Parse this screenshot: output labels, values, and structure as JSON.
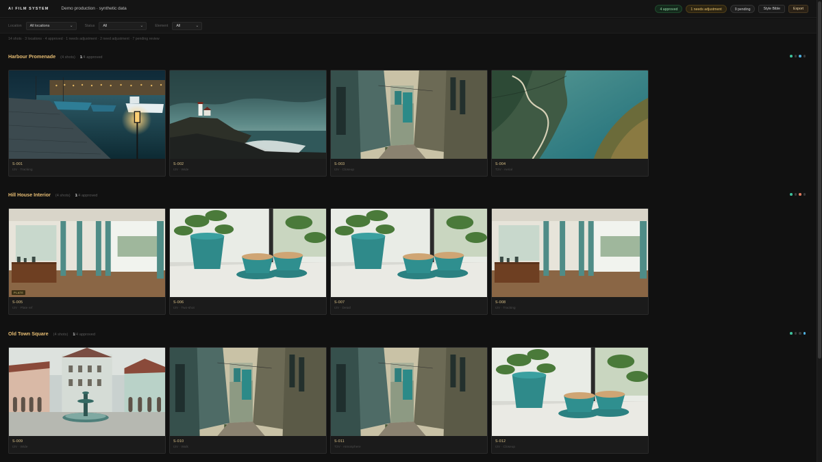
{
  "header": {
    "brand": "AI FILM SYSTEM",
    "project": "Demo production · synthetic data",
    "badges": {
      "approved": "4 approved",
      "adjust": "1 needs adjustment",
      "pending": "9 pending"
    },
    "style_bible": "Style Bible",
    "export": "Export"
  },
  "filters": {
    "location_label": "Location",
    "location_value": "All locations",
    "status_label": "Status",
    "status_value": "All",
    "element_label": "Element",
    "element_value": "All"
  },
  "summary": "14 shots · 3 locations · 4 approved · 1 needs adjustment · 2 need adjustment · 7 pending review",
  "sections": [
    {
      "title": "Harbour Promenade",
      "count": "(4 shots)",
      "approved_num": "1",
      "approved_rest": "/4 approved",
      "dot_colors": [
        "#3fbf9a",
        "#3a3a3a",
        "#4fb0e0",
        "#3a3a3a"
      ],
      "shots": [
        {
          "id": "S-001",
          "meta": "I2V · Tracking",
          "icon": "harbour-night-scene"
        },
        {
          "id": "S-002",
          "meta": "I2V · Wide",
          "icon": "lighthouse-cliff-scene"
        },
        {
          "id": "S-003",
          "meta": "I2V · Closeup",
          "icon": "narrow-alley-scene"
        },
        {
          "id": "S-004",
          "meta": "T2V · Aerial",
          "icon": "coastal-road-aerial-scene"
        }
      ]
    },
    {
      "title": "Hill House Interior",
      "count": "(4 shots)",
      "approved_num": "1",
      "approved_rest": "/4 approved",
      "dot_colors": [
        "#3fbf9a",
        "#3a3a3a",
        "#e07a5f",
        "#3a3a3a"
      ],
      "shots": [
        {
          "id": "S-005",
          "meta": "I2V · Plate ref",
          "icon": "living-room-scene",
          "plate": "PLATE"
        },
        {
          "id": "S-006",
          "meta": "I2V · Two-shot",
          "icon": "coffee-cups-scene"
        },
        {
          "id": "S-007",
          "meta": "I2V · Detail",
          "icon": "coffee-cups-scene"
        },
        {
          "id": "S-008",
          "meta": "I2V · Tracking",
          "icon": "living-room-scene"
        }
      ]
    },
    {
      "title": "Old Town Square",
      "count": "(4 shots)",
      "approved_num": "1",
      "approved_rest": "/4 approved",
      "dot_colors": [
        "#3fbf9a",
        "#3a3a3a",
        "#3a3a3a",
        "#4fb0e0"
      ],
      "shots": [
        {
          "id": "S-009",
          "meta": "I2V · Wide",
          "icon": "town-square-fountain-scene"
        },
        {
          "id": "S-010",
          "meta": "I2V · Walk",
          "icon": "narrow-alley-scene"
        },
        {
          "id": "S-011",
          "meta": "T2V · Atmosphere",
          "icon": "narrow-alley-scene"
        },
        {
          "id": "S-012",
          "meta": "I2V · Closeup",
          "icon": "coffee-cups-scene"
        }
      ]
    }
  ]
}
